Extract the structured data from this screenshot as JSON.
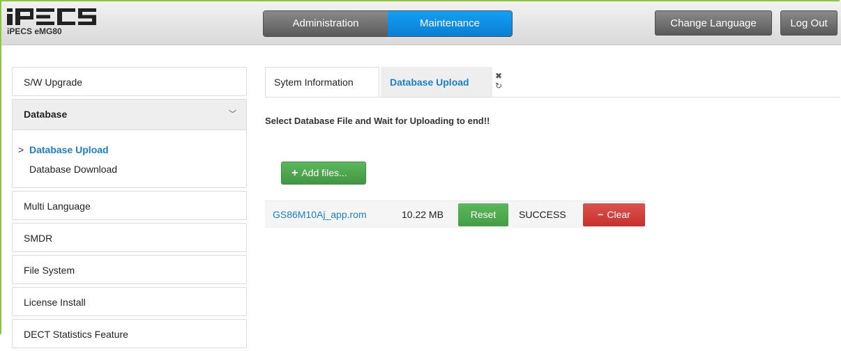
{
  "header": {
    "logo_text": "iPECS",
    "product": "iPECS eMG80",
    "nav": [
      {
        "label": "Administration"
      },
      {
        "label": "Maintenance"
      }
    ],
    "change_language": "Change Language",
    "logout": "Log Out",
    "active_color": "#0a8ae0"
  },
  "sidebar": {
    "items_top": [
      {
        "label": "S/W Upgrade"
      }
    ],
    "group": {
      "label": "Database",
      "chevron": "chevron-down-icon",
      "children": [
        {
          "label": "Database Upload",
          "active": true
        },
        {
          "label": "Database Download",
          "active": false
        }
      ]
    },
    "items_bottom": [
      {
        "label": "Multi Language"
      },
      {
        "label": "SMDR"
      },
      {
        "label": "File System"
      },
      {
        "label": "License Install"
      },
      {
        "label": "DECT Statistics Feature"
      }
    ]
  },
  "tabs": [
    {
      "label": "Sytem Information"
    },
    {
      "label": "Database Upload"
    }
  ],
  "instruction": "Select Database File and Wait for Uploading to end!!",
  "upload": {
    "add_files": "Add files...",
    "file": {
      "name": "GS86M10Aj_app.rom",
      "size": "10.22 MB",
      "reset": "Reset",
      "status": "SUCCESS",
      "clear": "Clear"
    }
  }
}
